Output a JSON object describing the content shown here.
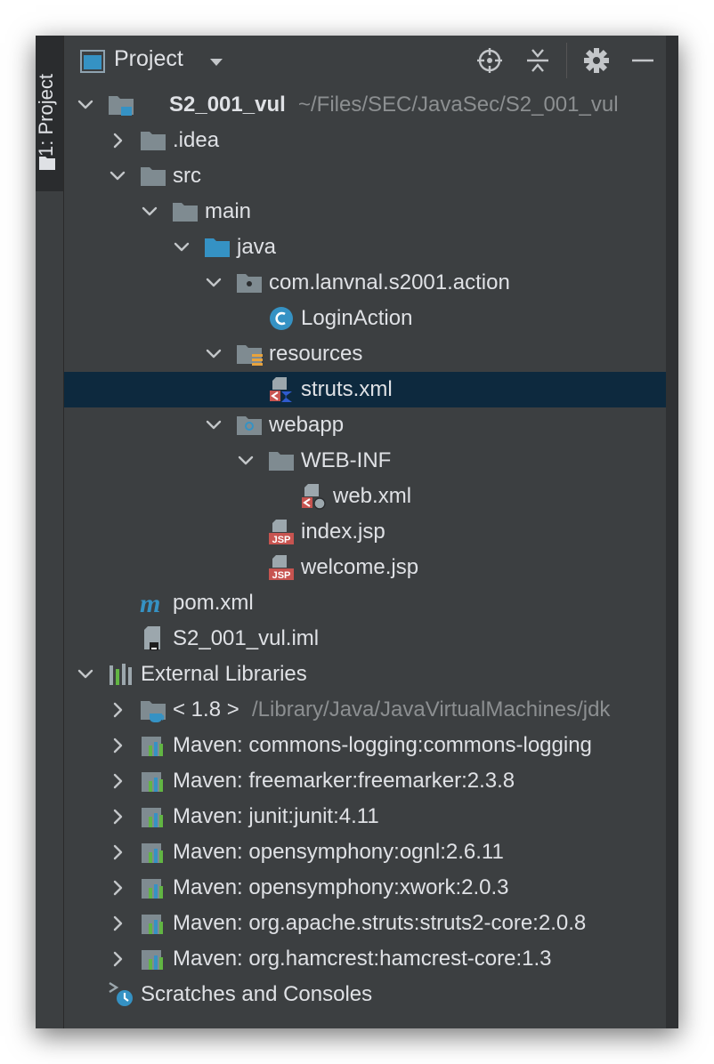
{
  "stripe": {
    "label": "1: Project"
  },
  "header": {
    "title": "Project",
    "icons": [
      "project-view-icon",
      "locate-icon",
      "collapse-all-icon",
      "settings-gear-icon",
      "minimize-icon"
    ]
  },
  "colors": {
    "background": "#3c3f41",
    "selection": "#0d293e",
    "text": "#dfe1e5",
    "path": "#8c8f91",
    "folder": "#7f8b91",
    "source_folder": "#3592c4"
  },
  "tree": [
    {
      "label": "S2_001_vul",
      "path": "~/Files/SEC/JavaSec/S2_001_vul",
      "expanded": "open",
      "icon": "module-folder-icon"
    },
    {
      "label": ".idea",
      "expanded": "closed",
      "icon": "folder-icon"
    },
    {
      "label": "src",
      "expanded": "open",
      "icon": "folder-icon"
    },
    {
      "label": "main",
      "expanded": "open",
      "icon": "folder-icon"
    },
    {
      "label": "java",
      "expanded": "open",
      "icon": "source-folder-icon"
    },
    {
      "label": "com.lanvnal.s2001.action",
      "expanded": "open",
      "icon": "package-icon"
    },
    {
      "label": "LoginAction",
      "icon": "java-class-icon"
    },
    {
      "label": "resources",
      "expanded": "open",
      "icon": "resources-folder-icon"
    },
    {
      "label": "struts.xml",
      "icon": "struts-xml-icon",
      "selected": true
    },
    {
      "label": "webapp",
      "expanded": "open",
      "icon": "web-folder-icon"
    },
    {
      "label": "WEB-INF",
      "expanded": "open",
      "icon": "folder-icon"
    },
    {
      "label": "web.xml",
      "icon": "web-xml-icon"
    },
    {
      "label": "index.jsp",
      "icon": "jsp-file-icon"
    },
    {
      "label": "welcome.jsp",
      "icon": "jsp-file-icon"
    },
    {
      "label": "pom.xml",
      "icon": "maven-icon"
    },
    {
      "label": "S2_001_vul.iml",
      "icon": "iml-file-icon"
    },
    {
      "label": "External Libraries",
      "expanded": "open",
      "icon": "libraries-icon"
    },
    {
      "label": "< 1.8 >",
      "path": "/Library/Java/JavaVirtualMachines/jdk",
      "expanded": "closed",
      "icon": "jdk-icon"
    },
    {
      "label": "Maven: commons-logging:commons-logging",
      "expanded": "closed",
      "icon": "library-icon"
    },
    {
      "label": "Maven: freemarker:freemarker:2.3.8",
      "expanded": "closed",
      "icon": "library-icon"
    },
    {
      "label": "Maven: junit:junit:4.11",
      "expanded": "closed",
      "icon": "library-icon"
    },
    {
      "label": "Maven: opensymphony:ognl:2.6.11",
      "expanded": "closed",
      "icon": "library-icon"
    },
    {
      "label": "Maven: opensymphony:xwork:2.0.3",
      "expanded": "closed",
      "icon": "library-icon"
    },
    {
      "label": "Maven: org.apache.struts:struts2-core:2.0.8",
      "expanded": "closed",
      "icon": "library-icon"
    },
    {
      "label": "Maven: org.hamcrest:hamcrest-core:1.3",
      "expanded": "closed",
      "icon": "library-icon"
    },
    {
      "label": "Scratches and Consoles",
      "icon": "scratches-icon"
    }
  ]
}
